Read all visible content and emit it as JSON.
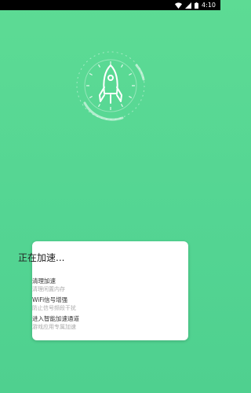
{
  "status_bar": {
    "time": "4:10",
    "icons": [
      "wifi-icon",
      "signal-icon",
      "battery-icon"
    ]
  },
  "hero": {
    "icon": "rocket-icon",
    "dial": "progress-dial"
  },
  "card": {
    "title": "正在加速...",
    "items": [
      {
        "title": "清理加速",
        "subtitle": "清理闲置内存"
      },
      {
        "title": "WiFi信号增强",
        "subtitle": "防止信号频段干扰"
      },
      {
        "title": "进入智能加速通道",
        "subtitle": "游戏应用专属加速"
      }
    ]
  },
  "colors": {
    "background_top": "#5ddb94",
    "background_bottom": "#4fd08f",
    "status_bar": "#000000",
    "card": "#ffffff"
  }
}
